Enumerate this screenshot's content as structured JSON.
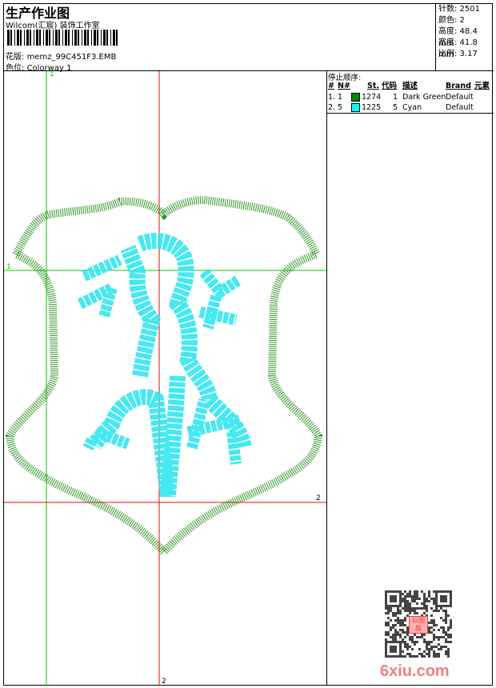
{
  "header": {
    "title": "生产作业图",
    "company": "Wilcom(汇宸) 装饰工作室",
    "design_label": "花版:",
    "design_file": "memz_99C451F3.EMB",
    "colorway_label": "色位:",
    "colorway": "Colorway 1"
  },
  "info": {
    "stitches": "针数: 2501",
    "colors": "颜色: 2",
    "height": "高度: 48.4 mm",
    "width": "宽度: 41.8 mm",
    "scale": "比例: 3.17"
  },
  "stop_sequence": {
    "caption": "停止顺序:",
    "headers": [
      "#",
      "N#",
      "St.",
      "代码",
      "描述",
      "Brand",
      "元素"
    ],
    "rows": [
      {
        "idx": "1.",
        "n": "1",
        "color": "#008800",
        "stitches": "1274",
        "code": "1",
        "desc": "Dark Green",
        "brand": "Default"
      },
      {
        "idx": "2.",
        "n": "5",
        "color": "#00ffff",
        "stitches": "1225",
        "code": "5",
        "desc": "Cyan",
        "brand": "Default"
      }
    ]
  },
  "guides": {
    "green_label": "1",
    "red_label": "2"
  },
  "colors": {
    "guide_green": "#00cc00",
    "guide_red": "#ff0000",
    "thread_green": "#1a8a10",
    "thread_cyan": "#33e6f0"
  },
  "watermark": {
    "logo": "6xiu.com",
    "stamp": "以图版"
  }
}
